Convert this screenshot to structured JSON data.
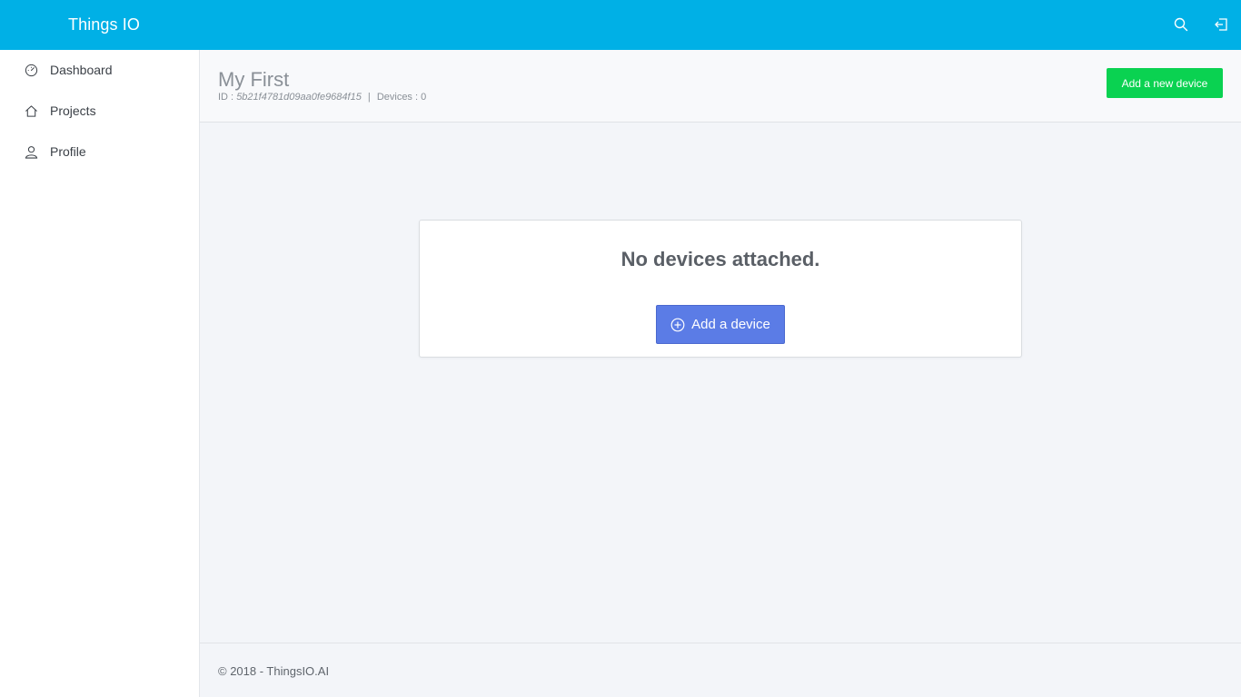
{
  "topbar": {
    "brand": "Things IO",
    "icons": [
      "search-icon",
      "logout-icon"
    ],
    "background": "#00b0e6"
  },
  "sidebar": {
    "items": [
      {
        "label": "Dashboard",
        "icon": "speedometer-icon"
      },
      {
        "label": "Projects",
        "icon": "home-icon"
      },
      {
        "label": "Profile",
        "icon": "user-icon"
      }
    ]
  },
  "header": {
    "title": "My First",
    "id_label": "ID :",
    "id_value": "5b21f4781d09aa0fe9684f15",
    "separator": "|",
    "devices_label": "Devices :",
    "devices_count": "0",
    "add_new_device_label": "Add a new device",
    "add_button_color": "#0ad251"
  },
  "main": {
    "empty_message": "No devices attached.",
    "add_device_label": "Add a device",
    "add_device_color": "#5b7ce6"
  },
  "footer": {
    "text": "© 2018 - ThingsIO.AI"
  }
}
